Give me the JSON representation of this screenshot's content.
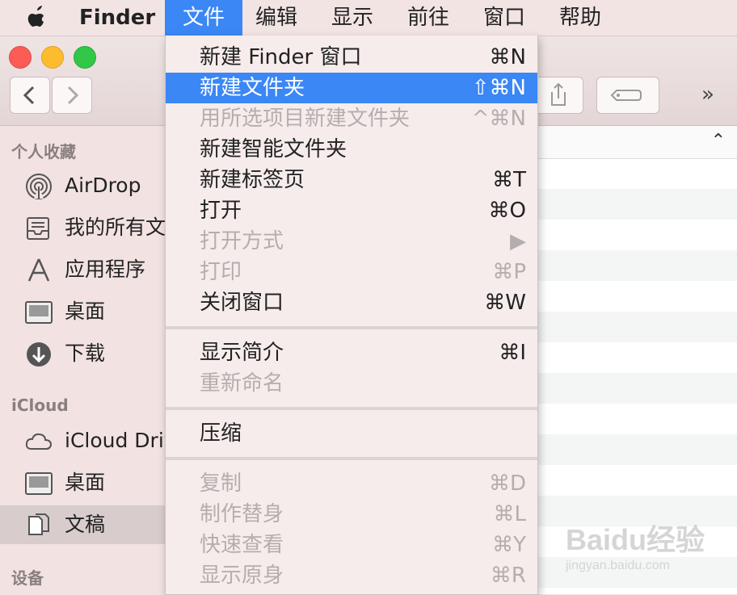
{
  "menubar": {
    "apple": "apple-icon",
    "items": [
      "Finder",
      "文件",
      "编辑",
      "显示",
      "前往",
      "窗口",
      "帮助"
    ]
  },
  "sidebar": {
    "sections": [
      "个人收藏",
      "iCloud",
      "设备"
    ],
    "favorites": [
      {
        "label": "AirDrop",
        "icon": "airdrop-icon"
      },
      {
        "label": "我的所有文",
        "icon": "all-files-icon"
      },
      {
        "label": "应用程序",
        "icon": "applications-icon"
      },
      {
        "label": "桌面",
        "icon": "desktop-icon"
      },
      {
        "label": "下载",
        "icon": "downloads-icon"
      }
    ],
    "icloud": [
      {
        "label": "iCloud Driv",
        "icon": "cloud-icon"
      },
      {
        "label": "桌面",
        "icon": "desktop-icon"
      },
      {
        "label": "文稿",
        "icon": "documents-icon",
        "selected": true
      }
    ]
  },
  "toolbar": {
    "more": "»"
  },
  "file_menu": {
    "items": [
      {
        "label": "新建 Finder 窗口",
        "shortcut": "⌘N",
        "state": "enabled"
      },
      {
        "label": "新建文件夹",
        "shortcut": "⇧⌘N",
        "state": "highlighted"
      },
      {
        "label": "用所选项目新建文件夹",
        "shortcut": "^⌘N",
        "state": "disabled"
      },
      {
        "label": "新建智能文件夹",
        "shortcut": "",
        "state": "enabled"
      },
      {
        "label": "新建标签页",
        "shortcut": "⌘T",
        "state": "enabled"
      },
      {
        "label": "打开",
        "shortcut": "⌘O",
        "state": "enabled"
      },
      {
        "label": "打开方式",
        "shortcut": "▶",
        "state": "disabled"
      },
      {
        "label": "打印",
        "shortcut": "⌘P",
        "state": "disabled"
      },
      {
        "label": "关闭窗口",
        "shortcut": "⌘W",
        "state": "enabled"
      },
      {
        "label": "显示简介",
        "shortcut": "⌘I",
        "state": "enabled"
      },
      {
        "label": "重新命名",
        "shortcut": "",
        "state": "disabled"
      },
      {
        "label": "压缩",
        "shortcut": "",
        "state": "enabled"
      },
      {
        "label": "复制",
        "shortcut": "⌘D",
        "state": "disabled"
      },
      {
        "label": "制作替身",
        "shortcut": "⌘L",
        "state": "disabled"
      },
      {
        "label": "快速查看",
        "shortcut": "⌘Y",
        "state": "disabled"
      },
      {
        "label": "显示原身",
        "shortcut": "⌘R",
        "state": "disabled"
      }
    ]
  },
  "watermark": {
    "text": "Baidu经验",
    "url_text": "jingyan.baidu.com"
  },
  "colors": {
    "highlight": "#3a87f5",
    "disabled_text": "#b4aeae"
  }
}
